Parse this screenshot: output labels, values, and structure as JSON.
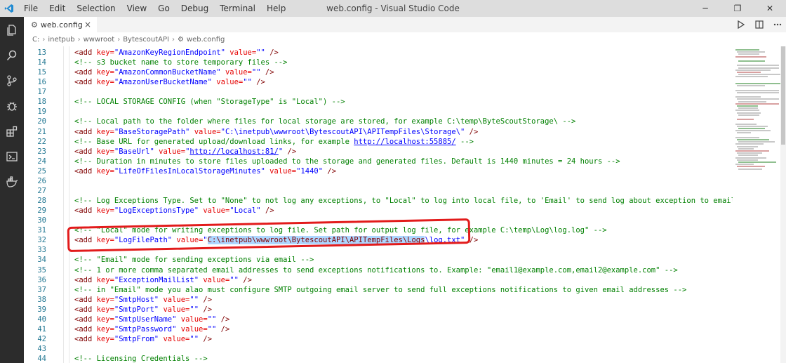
{
  "titlebar": {
    "menu": [
      "File",
      "Edit",
      "Selection",
      "View",
      "Go",
      "Debug",
      "Terminal",
      "Help"
    ],
    "window_title": "web.config - Visual Studio Code",
    "minimize": "─",
    "maximize": "❐",
    "close": "✕"
  },
  "activity_bar": {
    "icons": [
      "files-icon",
      "search-icon",
      "source-control-icon",
      "debug-icon",
      "extensions-icon",
      "remote-explorer-icon",
      "docker-icon"
    ]
  },
  "tabs": [
    {
      "label": "web.config",
      "icon": "gear-icon",
      "active": true
    }
  ],
  "breadcrumb": {
    "segments": [
      "C:",
      "inetpub",
      "wwwroot",
      "BytescoutAPI"
    ],
    "file": "web.config"
  },
  "editor": {
    "selection_color": "#add6ff",
    "lines": [
      {
        "n": "13",
        "segs": [
          [
            "br",
            "<add "
          ],
          [
            "attr",
            "key="
          ],
          [
            "str",
            "\"AmazonKeyRegionEndpoint\""
          ],
          [
            "attr",
            " value="
          ],
          [
            "str",
            "\"\""
          ],
          [
            "br",
            " />"
          ]
        ]
      },
      {
        "n": "14",
        "segs": [
          [
            "com",
            "<!-- s3 bucket name to store temporary files -->"
          ]
        ]
      },
      {
        "n": "15",
        "segs": [
          [
            "br",
            "<add "
          ],
          [
            "attr",
            "key="
          ],
          [
            "str",
            "\"AmazonCommonBucketName\""
          ],
          [
            "attr",
            " value="
          ],
          [
            "str",
            "\"\""
          ],
          [
            "br",
            " />"
          ]
        ]
      },
      {
        "n": "16",
        "segs": [
          [
            "br",
            "<add "
          ],
          [
            "attr",
            "key="
          ],
          [
            "str",
            "\"AmazonUserBucketName\""
          ],
          [
            "attr",
            " value="
          ],
          [
            "str",
            "\"\""
          ],
          [
            "br",
            " />"
          ]
        ]
      },
      {
        "n": "17",
        "segs": []
      },
      {
        "n": "18",
        "segs": [
          [
            "com",
            "<!-- LOCAL STORAGE CONFIG (when \"StorageType\" is \"Local\") -->"
          ]
        ]
      },
      {
        "n": "19",
        "segs": []
      },
      {
        "n": "20",
        "segs": [
          [
            "com",
            "<!-- Local path to the folder where files for local storage are stored, for example C:\\temp\\ByteScoutStorage\\ -->"
          ]
        ]
      },
      {
        "n": "21",
        "segs": [
          [
            "br",
            "<add "
          ],
          [
            "attr",
            "key="
          ],
          [
            "str",
            "\"BaseStoragePath\""
          ],
          [
            "attr",
            " value="
          ],
          [
            "str",
            "\"C:\\inetpub\\wwwroot\\BytescoutAPI\\APITempFiles\\Storage\\\""
          ],
          [
            "br",
            " />"
          ]
        ]
      },
      {
        "n": "22",
        "segs": [
          [
            "com",
            "<!-- Base URL for generated upload/download links, for example "
          ],
          [
            "link",
            "http://localhost:55885/"
          ],
          [
            "com",
            " -->"
          ]
        ]
      },
      {
        "n": "23",
        "segs": [
          [
            "br",
            "<add "
          ],
          [
            "attr",
            "key="
          ],
          [
            "str",
            "\"BaseUrl\""
          ],
          [
            "attr",
            " value="
          ],
          [
            "str",
            "\""
          ],
          [
            "link",
            "http://localhost:81/"
          ],
          [
            "str",
            "\""
          ],
          [
            "br",
            " />"
          ]
        ]
      },
      {
        "n": "24",
        "segs": [
          [
            "com",
            "<!-- Duration in minutes to store files uploaded to the storage and generated files. Default is 1440 minutes = 24 hours -->"
          ]
        ]
      },
      {
        "n": "25",
        "segs": [
          [
            "br",
            "<add "
          ],
          [
            "attr",
            "key="
          ],
          [
            "str",
            "\"LifeOfFilesInLocalStorageMinutes\""
          ],
          [
            "attr",
            " value="
          ],
          [
            "str",
            "\"1440\""
          ],
          [
            "br",
            " />"
          ]
        ]
      },
      {
        "n": "26",
        "segs": []
      },
      {
        "n": "27",
        "segs": []
      },
      {
        "n": "28",
        "segs": [
          [
            "com",
            "<!-- Log Exceptions Type. Set to \"None\" to not log any exceptions, to \"Local\" to log into local file, to 'Email' to send log about exception to email, to 'LocalAndEma"
          ]
        ]
      },
      {
        "n": "29",
        "segs": [
          [
            "br",
            "<add "
          ],
          [
            "attr",
            "key="
          ],
          [
            "str",
            "\"LogExceptionsType\""
          ],
          [
            "attr",
            " value="
          ],
          [
            "str",
            "\"Local\""
          ],
          [
            "br",
            " />"
          ]
        ]
      },
      {
        "n": "30",
        "segs": []
      },
      {
        "n": "31",
        "segs": [
          [
            "com",
            "<!-- \"Local\" mode for writing exceptions to log file. Set path for output log file, for example C:\\temp\\Log\\log.log\" -->"
          ]
        ]
      },
      {
        "n": "32",
        "segs": [
          [
            "br",
            "<add "
          ],
          [
            "attr",
            "key="
          ],
          [
            "str",
            "\"LogFilePath\""
          ],
          [
            "attr",
            " value="
          ],
          [
            "str",
            "\""
          ],
          [
            "sel",
            "C:\\inetpub\\wwwroot\\BytescoutAPI\\APITempFiles\\Logs"
          ],
          [
            "str",
            "\\log.txt\""
          ],
          [
            "br",
            " />"
          ]
        ]
      },
      {
        "n": "33",
        "segs": []
      },
      {
        "n": "34",
        "segs": [
          [
            "com",
            "<!-- \"Email\" mode for sending exceptions via email -->"
          ]
        ]
      },
      {
        "n": "35",
        "segs": [
          [
            "com",
            "<!-- 1 or more comma separated email addresses to send exceptions notifications to. Example: \"email1@example.com,email2@example.com\" -->"
          ]
        ]
      },
      {
        "n": "36",
        "segs": [
          [
            "br",
            "<add "
          ],
          [
            "attr",
            "key="
          ],
          [
            "str",
            "\"ExceptionMailList\""
          ],
          [
            "attr",
            " value="
          ],
          [
            "str",
            "\"\""
          ],
          [
            "br",
            " />"
          ]
        ]
      },
      {
        "n": "37",
        "segs": [
          [
            "com",
            "<!-- in \"Email\" mode you alao must configure SMTP outgoing email server to send full exceptions notifications to given email addresses -->"
          ]
        ]
      },
      {
        "n": "38",
        "segs": [
          [
            "br",
            "<add "
          ],
          [
            "attr",
            "key="
          ],
          [
            "str",
            "\"SmtpHost\""
          ],
          [
            "attr",
            " value="
          ],
          [
            "str",
            "\"\""
          ],
          [
            "br",
            " />"
          ]
        ]
      },
      {
        "n": "39",
        "segs": [
          [
            "br",
            "<add "
          ],
          [
            "attr",
            "key="
          ],
          [
            "str",
            "\"SmtpPort\""
          ],
          [
            "attr",
            " value="
          ],
          [
            "str",
            "\"\""
          ],
          [
            "br",
            " />"
          ]
        ]
      },
      {
        "n": "40",
        "segs": [
          [
            "br",
            "<add "
          ],
          [
            "attr",
            "key="
          ],
          [
            "str",
            "\"SmtpUserName\""
          ],
          [
            "attr",
            " value="
          ],
          [
            "str",
            "\"\""
          ],
          [
            "br",
            " />"
          ]
        ]
      },
      {
        "n": "41",
        "segs": [
          [
            "br",
            "<add "
          ],
          [
            "attr",
            "key="
          ],
          [
            "str",
            "\"SmtpPassword\""
          ],
          [
            "attr",
            " value="
          ],
          [
            "str",
            "\"\""
          ],
          [
            "br",
            " />"
          ]
        ]
      },
      {
        "n": "42",
        "segs": [
          [
            "br",
            "<add "
          ],
          [
            "attr",
            "key="
          ],
          [
            "str",
            "\"SmtpFrom\""
          ],
          [
            "attr",
            " value="
          ],
          [
            "str",
            "\"\""
          ],
          [
            "br",
            " />"
          ]
        ]
      },
      {
        "n": "43",
        "segs": []
      },
      {
        "n": "44",
        "segs": [
          [
            "com",
            "<!-- Licensing Credentials -->"
          ]
        ]
      }
    ]
  }
}
